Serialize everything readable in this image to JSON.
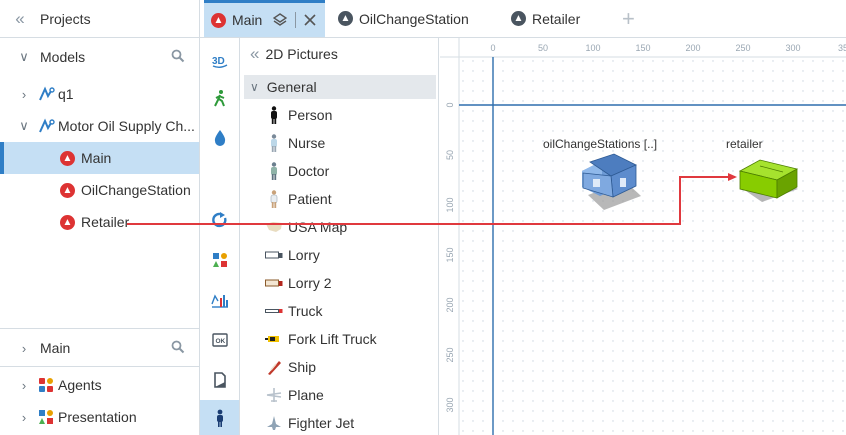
{
  "projects_panel": {
    "title": "Projects",
    "models_label": "Models",
    "tree": {
      "q1": "q1",
      "model": "Motor Oil Supply Ch...",
      "agents": [
        "Main",
        "OilChangeStation",
        "Retailer"
      ]
    },
    "bottom": {
      "main_label": "Main",
      "agents_label": "Agents",
      "presentation_label": "Presentation"
    }
  },
  "tabs": [
    {
      "label": "Main"
    },
    {
      "label": "OilChangeStation"
    },
    {
      "label": "Retailer"
    }
  ],
  "tab_add": "+",
  "palette": {
    "title": "2D Pictures",
    "group": "General",
    "items": [
      "Person",
      "Nurse",
      "Doctor",
      "Patient",
      "USA Map",
      "Lorry",
      "Lorry 2",
      "Truck",
      "Fork Lift Truck",
      "Ship",
      "Plane",
      "Fighter Jet"
    ]
  },
  "canvas": {
    "ruler_x": [
      "0",
      "50",
      "100",
      "150",
      "200",
      "250",
      "300",
      "35"
    ],
    "ruler_y": [
      "0",
      "50",
      "100",
      "150",
      "200",
      "250",
      "300"
    ],
    "nodes": {
      "station_label": "oilChangeStations [..]",
      "retailer_label": "retailer"
    }
  },
  "colors": {
    "accent": "#2f7ec6",
    "selection": "#c5dff4",
    "agent_icon": "#d33333",
    "connector": "#e0393e",
    "retailer_fill": "#88cc00"
  }
}
